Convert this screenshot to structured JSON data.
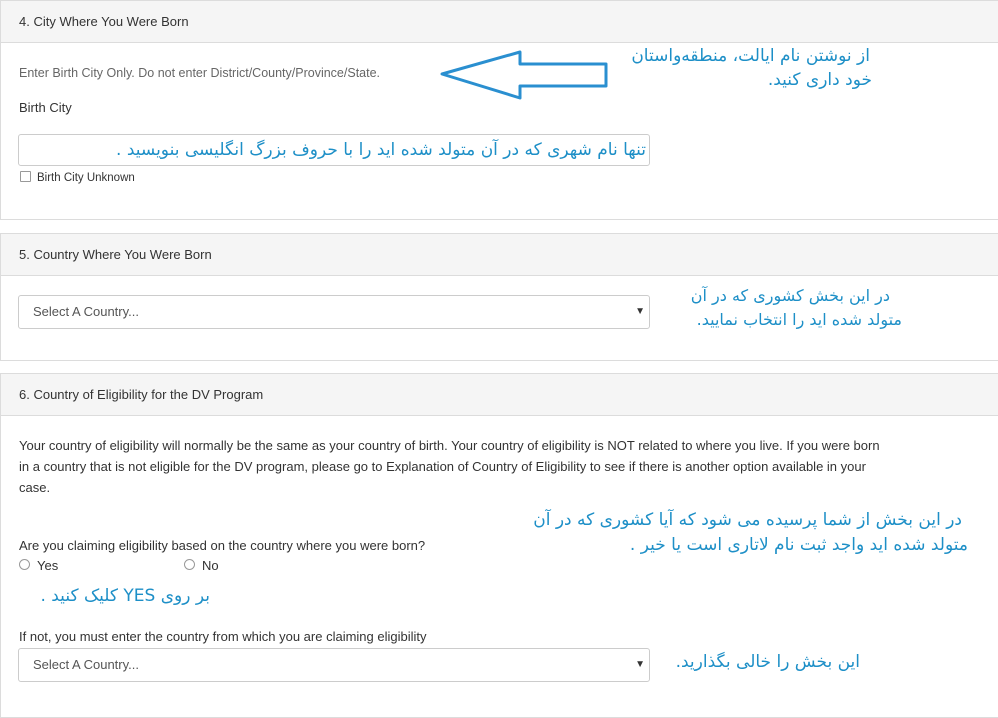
{
  "section4": {
    "title": "4. City Where You Were Born",
    "hint": "Enter Birth City Only. Do not enter District/County/Province/State.",
    "label": "Birth City",
    "input_value": "",
    "input_annotation": "تنها نام شهری که در آن متولد شده اید را با حروف بزرگ انگلیسی بنویسید .",
    "checkbox_label": "Birth City Unknown",
    "annotation_line1": "از نوشتن نام ایالت، منطقه‌واستان",
    "annotation_line2": "خود داری کنید."
  },
  "section5": {
    "title": "5. Country Where You Were Born",
    "select_value": "Select A Country...",
    "annotation_line1": "در این بخش کشوری که در آن",
    "annotation_line2": "متولد شده اید را انتخاب نمایید."
  },
  "section6": {
    "title": "6. Country of Eligibility for the DV Program",
    "paragraph_line1": "Your country of eligibility will normally be the same as your country of birth. Your country of eligibility is NOT related to where you live. If you were born",
    "paragraph_line2": "in a country that is not eligible for the DV program, please go to Explanation of Country of Eligibility to see if there is another option available in your",
    "paragraph_line3": "case.",
    "question": "Are you claiming eligibility based on the country where you were born?",
    "option_yes": "Yes",
    "option_no": "No",
    "annotation_line1": "در این بخش از شما پرسیده می شود که آیا   کشوری که در آن",
    "annotation_line2": "متولد شده  اید واجد ثبت نام لاتاری است یا خیر .",
    "annotation_yes": "بر روی YES کلیک کنید .",
    "if_not_label": "If not, you must enter the country from which you are claiming eligibility",
    "select_value": "Select A Country...",
    "annotation_blank": "این بخش را خالی بگذارید."
  },
  "colors": {
    "annotation": "#1d8fc7",
    "header_bg": "#f5f5f5",
    "border": "#dcdcdc"
  }
}
